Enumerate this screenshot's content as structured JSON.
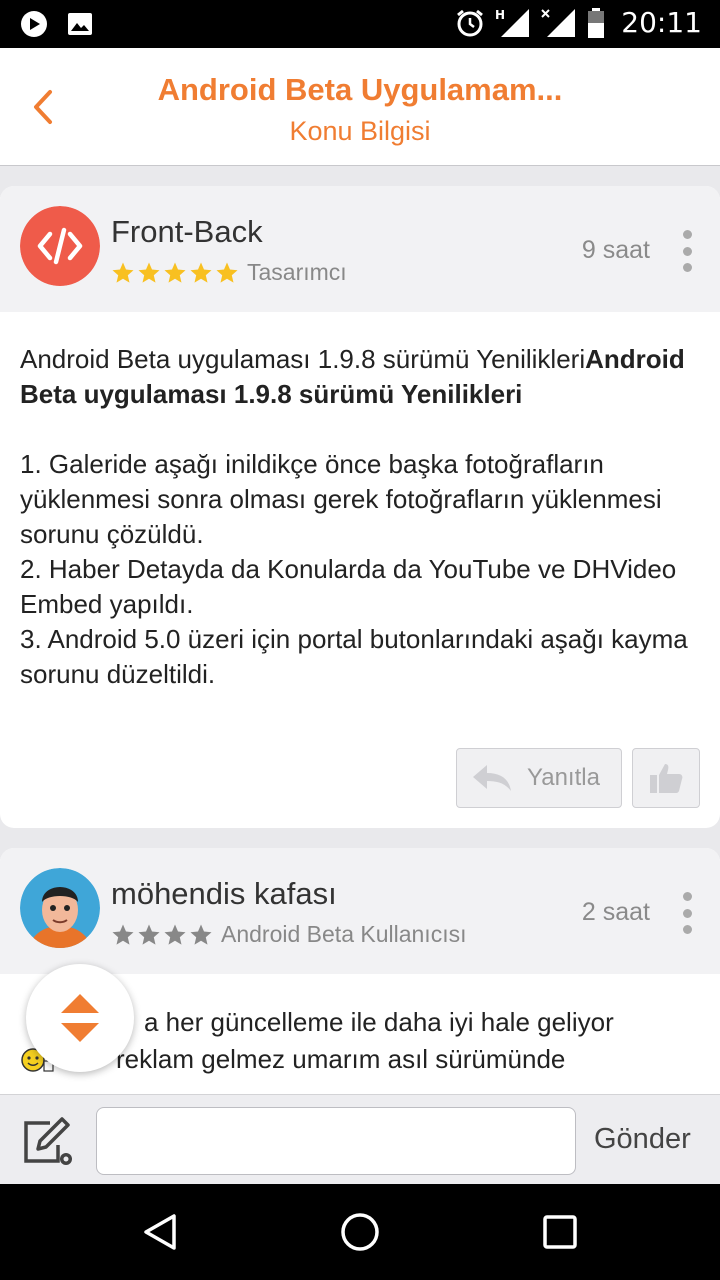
{
  "status_bar": {
    "time": "20:11",
    "icons": [
      "play-store-icon",
      "image-icon",
      "alarm-icon",
      "signal-h-icon",
      "signal-x-icon",
      "battery-icon"
    ]
  },
  "app_bar": {
    "title": "Android Beta Uygulamam...",
    "subtitle": "Konu Bilgisi",
    "accent": "#f07d32"
  },
  "posts": [
    {
      "author": "Front-Back",
      "stars": 5,
      "role": "Tasarımcı",
      "time": "9 saat",
      "title_plain": "Android Beta uygulaması 1.9.8 sürümü Yenilikleri",
      "title_bold": "Android Beta uygulaması 1.9.8 sürümü Yenilikleri",
      "lines": [
        "1. Galeride aşağı inildikçe önce başka fotoğrafların yüklenmesi sonra olması gerek fotoğrafların yüklenmesi sorunu çözüldü.",
        "2. Haber Detayda da Konularda da YouTube ve DHVideo Embed yapıldı.",
        "3. Android 5.0 üzeri için portal butonlarındaki aşağı kayma sorunu düzeltildi."
      ],
      "reply_label": "Yanıtla"
    },
    {
      "author": "möhendis kafası",
      "stars": 4,
      "role": "Android Beta Kullanıcısı",
      "time": "2 saat",
      "line1": "a her güncelleme ile daha iyi hale geliyor",
      "line2": "reklam gelmez umarım asıl sürümünde"
    }
  ],
  "composer": {
    "input_value": "",
    "send_label": "Gönder"
  }
}
